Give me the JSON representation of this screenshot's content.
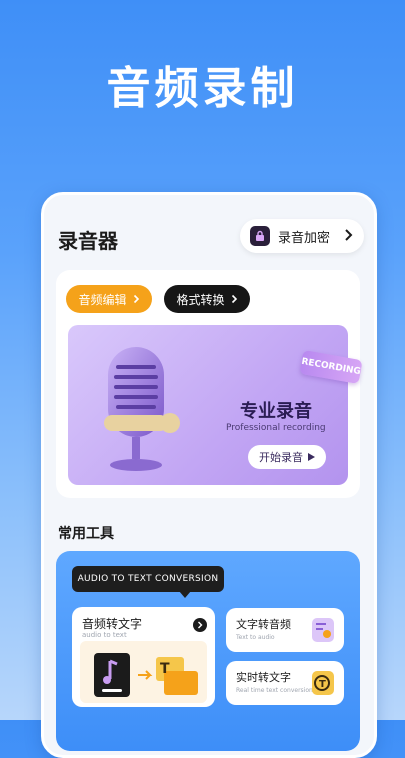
{
  "hero": {
    "title": "音频录制"
  },
  "app": {
    "title": "录音器",
    "encrypt_label": "录音加密",
    "pills": {
      "edit": "音频编辑",
      "format": "格式转换"
    },
    "badge": "RECORDING",
    "banner": {
      "title": "专业录音",
      "subtitle": "Professional recording",
      "start": "开始录音"
    },
    "section_title": "常用工具",
    "tooltip": "AUDIO TO TEXT CONVERSION",
    "tools": {
      "audio_to_text": {
        "title": "音频转文字",
        "sub": "audio to text"
      },
      "text_to_audio": {
        "title": "文字转音频",
        "sub": "Text to audio"
      },
      "realtime": {
        "title": "实时转文字",
        "sub": "Real time text conversion"
      }
    }
  },
  "colors": {
    "accent_orange": "#f5a21a",
    "banner_purple": "#c2a6f4",
    "tools_blue": "#3d8ef8"
  }
}
